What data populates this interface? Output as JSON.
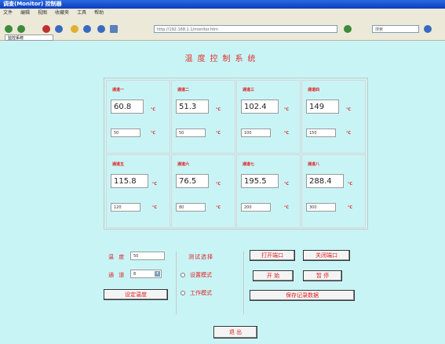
{
  "window": {
    "title": "调查(Monitor) 控制器"
  },
  "menu": [
    "文件",
    "编辑",
    "视图",
    "收藏夹",
    "工具",
    "帮助"
  ],
  "toolbar": {
    "address": "http://192.168.1.1/monitor.htm",
    "search": "搜索"
  },
  "tab": {
    "label": "监控系统"
  },
  "page": {
    "title": "温度控制系统"
  },
  "channels": [
    {
      "label": "通道一",
      "value": "60.8",
      "unit": "℃",
      "set_value": "50",
      "set_unit": "℃"
    },
    {
      "label": "通道二",
      "value": "51.3",
      "unit": "℃",
      "set_value": "50",
      "set_unit": "℃"
    },
    {
      "label": "通道三",
      "value": "102.4",
      "unit": "℃",
      "set_value": "100",
      "set_unit": "℃"
    },
    {
      "label": "通道四",
      "value": "149",
      "unit": "℃",
      "set_value": "150",
      "set_unit": "℃"
    },
    {
      "label": "通道五",
      "value": "115.8",
      "unit": "℃",
      "set_value": "120",
      "set_unit": "℃"
    },
    {
      "label": "通道六",
      "value": "76.5",
      "unit": "℃",
      "set_value": "80",
      "set_unit": "℃"
    },
    {
      "label": "通道七",
      "value": "195.5",
      "unit": "℃",
      "set_value": "200",
      "set_unit": "℃"
    },
    {
      "label": "通道八",
      "value": "288.4",
      "unit": "℃",
      "set_value": "300",
      "set_unit": "℃"
    }
  ],
  "controls": {
    "temp_label": "温 度",
    "temp_value": "50",
    "channel_label": "通 道",
    "channel_value": "8",
    "set_button": "设定温度",
    "mode_title": "测试选择",
    "mode_options": [
      "设置模式",
      "工作模式"
    ],
    "open_port": "打开端口",
    "close_port": "关闭端口",
    "start": "开 始",
    "pause": "暂 停",
    "save_data": "保存记录数据",
    "exit": "退 出"
  }
}
